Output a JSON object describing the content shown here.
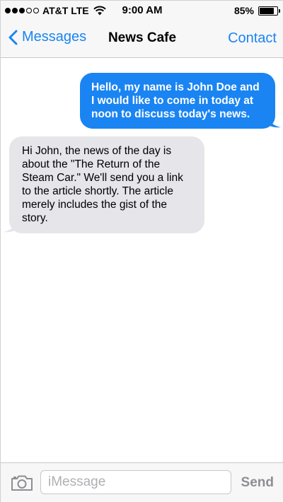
{
  "status_bar": {
    "carrier": "AT&T",
    "network": "LTE",
    "time": "9:00 AM",
    "battery_text": "85%",
    "battery_level": 0.85,
    "signal_bars": 3,
    "signal_total": 5
  },
  "nav": {
    "back_label": "Messages",
    "title": "News Cafe",
    "contact_label": "Contact"
  },
  "messages": [
    {
      "direction": "outgoing",
      "text": "Hello, my name is John Doe and I would like to come in today at noon to discuss today's news."
    },
    {
      "direction": "incoming",
      "text": "Hi John, the news of the day is about the \"The Return of the Steam Car.\" We'll send you a link to the article shortly. The article merely includes the gist of the story."
    }
  ],
  "input_bar": {
    "placeholder": "iMessage",
    "value": "",
    "send_label": "Send",
    "camera_icon": "camera-icon"
  },
  "colors": {
    "accent": "#1a84f2",
    "incoming_bubble": "#e5e5ea",
    "bar_background": "#f7f7f7",
    "send_disabled": "#8e8e93"
  }
}
